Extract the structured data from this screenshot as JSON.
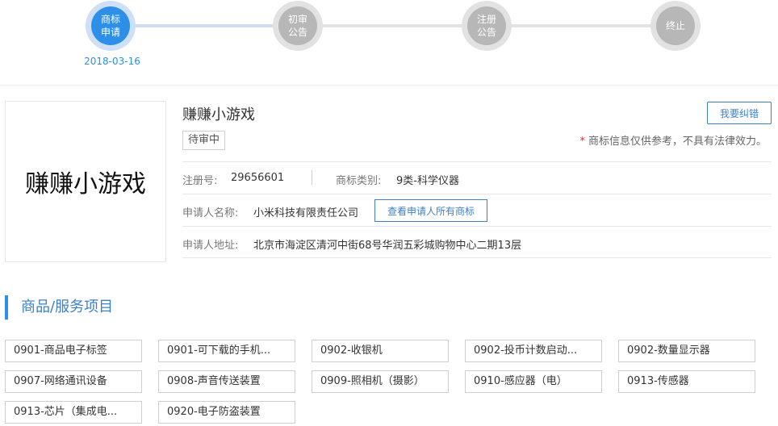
{
  "timeline": {
    "steps": [
      {
        "label": "商标\n申请",
        "state": "active"
      },
      {
        "label": "初审\n公告",
        "state": "inactive"
      },
      {
        "label": "注册\n公告",
        "state": "inactive"
      },
      {
        "label": "终止",
        "state": "inactive"
      }
    ],
    "date": "2018-03-16",
    "colors": {
      "active": "#2e8fe9",
      "inactive": "#b7b7b7"
    }
  },
  "trademark": {
    "logo_text": "赚赚小游戏",
    "name": "赚赚小游戏",
    "status": "待审中",
    "report_label": "我要纠错",
    "disclaimer_star": "*",
    "disclaimer": "商标信息仅供参考，不具有法律效力。"
  },
  "info": {
    "reg_no_label": "注册号:",
    "reg_no": "29656601",
    "class_label": "商标类别:",
    "class_value": "9类-科学仪器",
    "applicant_label": "申请人名称:",
    "applicant": "小米科技有限责任公司",
    "view_all_label": "查看申请人所有商标",
    "address_label": "申请人地址:",
    "address": "北京市海淀区清河中街68号华润五彩城购物中心二期13层"
  },
  "section": {
    "title": "商品/服务项目"
  },
  "goods": [
    "0901-商品电子标签",
    "0901-可下载的手机...",
    "0902-收银机",
    "0902-投币计数启动...",
    "0902-数量显示器",
    "0907-网络通讯设备",
    "0908-声音传送装置",
    "0909-照相机（摄影）",
    "0910-感应器（电）",
    "0913-传感器",
    "0913-芯片（集成电...",
    "0920-电子防盗装置"
  ]
}
